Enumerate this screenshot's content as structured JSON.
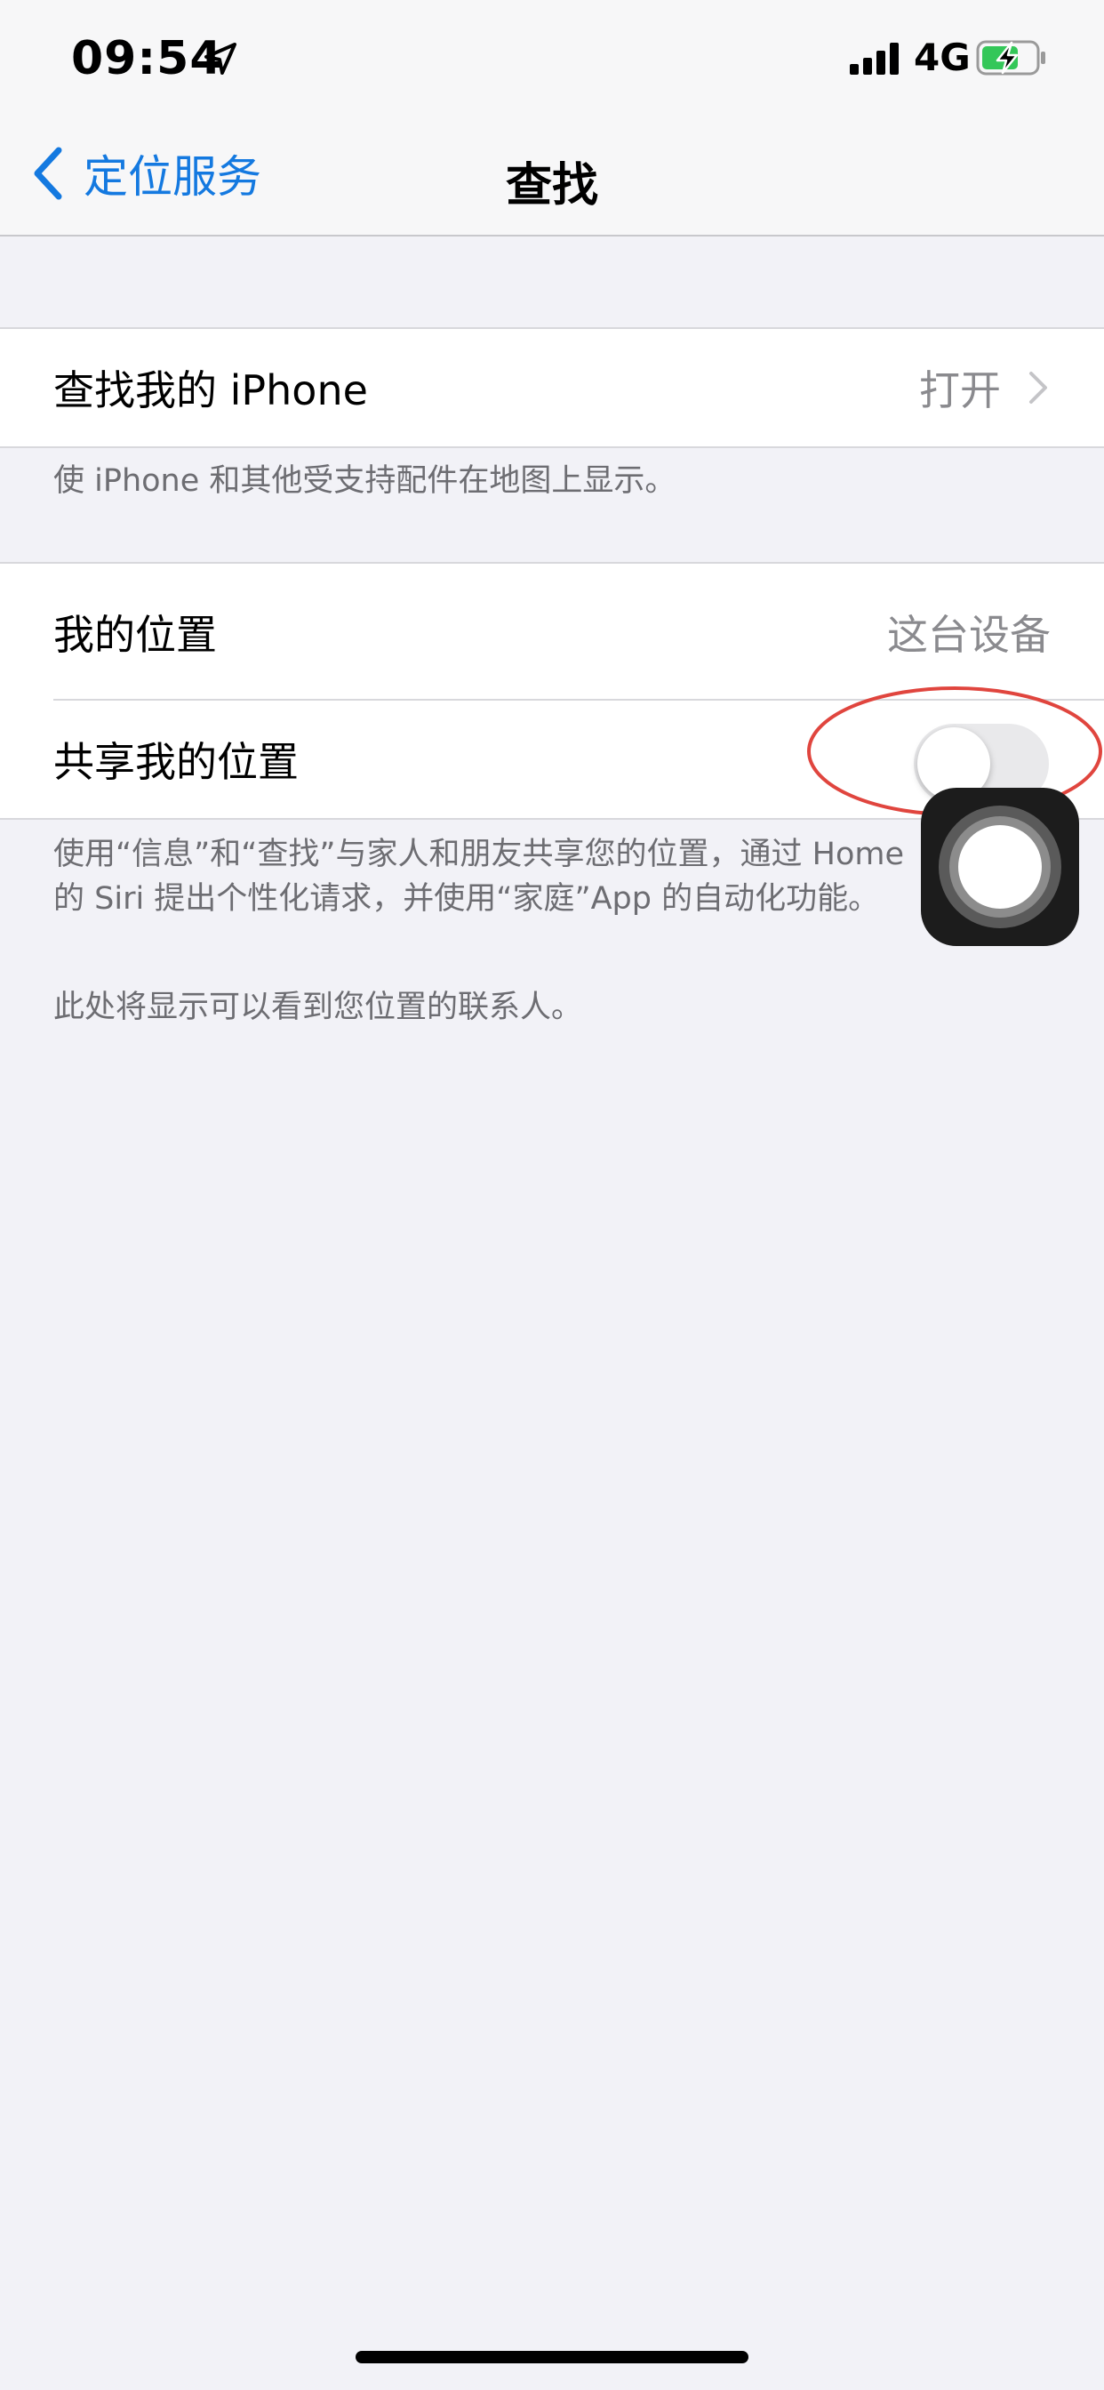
{
  "status_bar": {
    "time": "09:54",
    "network": "4G",
    "icons": [
      "location-arrow-icon",
      "cellular-signal-icon",
      "battery-charging-icon"
    ],
    "battery_color": "#34c759"
  },
  "nav": {
    "back_label": "定位服务",
    "title": "查找",
    "accent_color": "#1479e0"
  },
  "find_my_iphone": {
    "label": "查找我的 iPhone",
    "value": "打开",
    "footer": "使 iPhone 和其他受支持配件在地图上显示。"
  },
  "my_location": {
    "label": "我的位置",
    "value": "这台设备"
  },
  "share_location": {
    "label": "共享我的位置",
    "enabled": false,
    "footer_line1": "使用“信息”和“查找”与家人和朋友共享您的位置，通过 Home",
    "footer_line2": "的 Siri 提出个性化请求，并使用“家庭”App 的自动化功能。"
  },
  "contacts_note": "此处将显示可以看到您位置的联系人。"
}
